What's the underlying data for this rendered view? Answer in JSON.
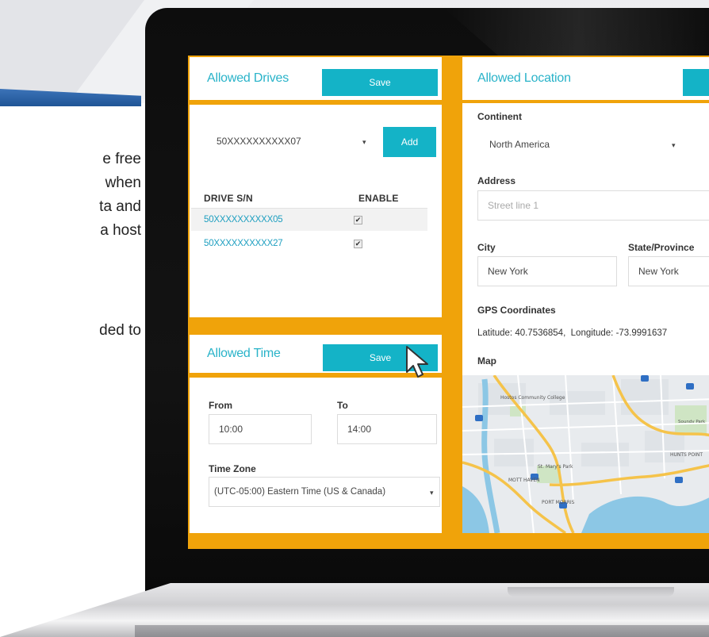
{
  "slide": {
    "lines": [
      "e free",
      "when",
      "ta and",
      "a host"
    ],
    "line2": "ded to"
  },
  "drives_panel": {
    "title": "Allowed Drives",
    "save_label": "Save",
    "selected_drive": "50XXXXXXXXXX07",
    "add_label": "Add",
    "col_serial": "DRIVE S/N",
    "col_enable": "ENABLE",
    "rows": [
      {
        "serial": "50XXXXXXXXXX05",
        "enabled": "✔"
      },
      {
        "serial": "50XXXXXXXXXX27",
        "enabled": "✔"
      }
    ]
  },
  "time_panel": {
    "title": "Allowed Time",
    "save_label": "Save",
    "from_label": "From",
    "to_label": "To",
    "from_value": "10:00",
    "to_value": "14:00",
    "tz_label": "Time Zone",
    "tz_value": "(UTC-05:00) Eastern Time (US & Canada)"
  },
  "location_panel": {
    "title": "Allowed Location",
    "continent_label": "Continent",
    "continent_value": "North America",
    "address_label": "Address",
    "address_placeholder": "Street line 1",
    "city_label": "City",
    "city_value": "New York",
    "state_label": "State/Province",
    "state_value": "New York",
    "gps_label": "GPS Coordinates",
    "gps_value": "Latitude: 40.7536854,  Longitude: -73.9991637",
    "map_label": "Map",
    "map_places": {
      "college": "Hostos Community College",
      "park": "St. Mary's Park",
      "mott": "MOTT HAVEN",
      "hunts": "HUNTS POINT",
      "port": "PORT MORRIS",
      "sound": "Soundv Park"
    }
  },
  "colors": {
    "accent_orange": "#f0a30a",
    "accent_teal": "#14b3c7",
    "title_teal": "#29b3c9",
    "link_blue": "#1e9fc0"
  }
}
